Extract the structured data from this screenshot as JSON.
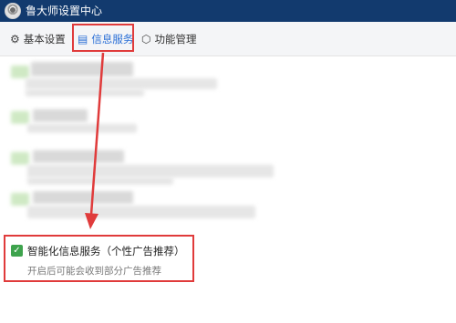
{
  "window": {
    "title": "鲁大师设置中心",
    "accent": "#123a6e"
  },
  "tabs": [
    {
      "label": "基本设置",
      "icon": "gear-icon",
      "active": false
    },
    {
      "label": "信息服务",
      "icon": "document-icon",
      "active": true
    },
    {
      "label": "功能管理",
      "icon": "cube-icon",
      "active": false
    }
  ],
  "option": {
    "title": "智能化信息服务（个性广告推荐）",
    "description": "开启后可能会收到部分广告推荐",
    "checked": true,
    "check_glyph": "✓"
  },
  "annotation_color": "#e03b3b"
}
